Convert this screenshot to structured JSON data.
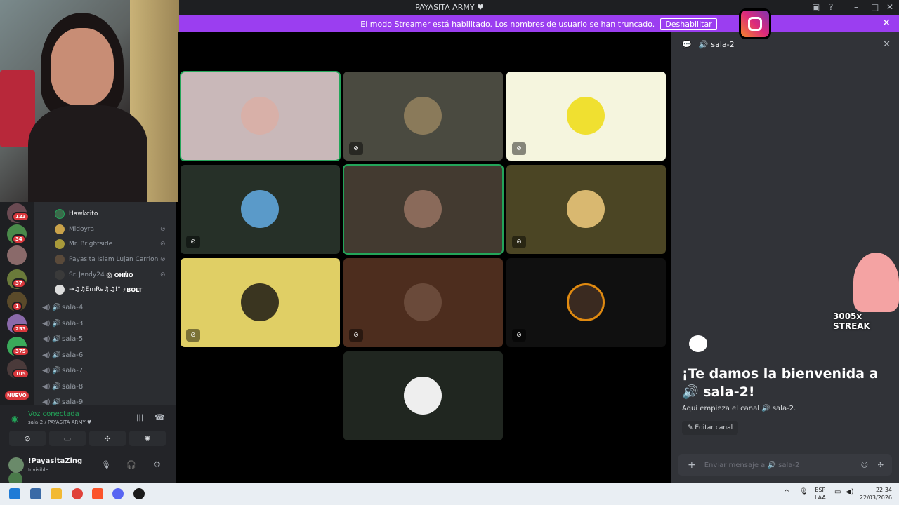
{
  "window": {
    "title": "PAYASITA ARMY ♥"
  },
  "banner": {
    "text": "El modo Streamer está habilitado. Los nombres de usuario se han truncado.",
    "button": "Deshabilitar"
  },
  "servers": {
    "badges": [
      "123",
      "34",
      "37",
      "1",
      "253",
      "375",
      "105"
    ],
    "new_label": "NUEVO"
  },
  "members": [
    {
      "name": "Hawkcito",
      "tag": ""
    },
    {
      "name": "Midoyra",
      "tag": ""
    },
    {
      "name": "Mr. Brightside",
      "tag": ""
    },
    {
      "name": "Payasita Islam Lujan Carrion",
      "tag": ""
    },
    {
      "name": "Sr. Jandy24",
      "tag": "😱 OHÑO"
    },
    {
      "name": "→♫♫EmRe♫♫!°",
      "tag": "⚡BOLT"
    }
  ],
  "channels": [
    "sala-4",
    "sala-3",
    "sala-5",
    "sala-6",
    "sala-7",
    "sala-8",
    "sala-9"
  ],
  "voice": {
    "status": "Voz conectada",
    "location": "sala-2 / PAYASITA ARMY ♥"
  },
  "user": {
    "name": "!PayasitaZing",
    "status": "Invisible"
  },
  "chat": {
    "channel": "sala-2",
    "welcome": "¡Te damos la bienvenida a 🔊 sala-2!",
    "subtitle": "Aquí empieza el canal 🔊 sala-2.",
    "edit_button": "Editar canal",
    "input_placeholder": "Enviar mensaje a 🔊 sala-2"
  },
  "overlay": {
    "streak": "3005x STREAK"
  },
  "taskbar": {
    "lang": "ESP",
    "lang2": "LAA",
    "time": "22:34",
    "date": "22/03/2026"
  },
  "colors": {
    "accent": "#9b3ef0",
    "speaking": "#23a559",
    "danger": "#da373c"
  }
}
